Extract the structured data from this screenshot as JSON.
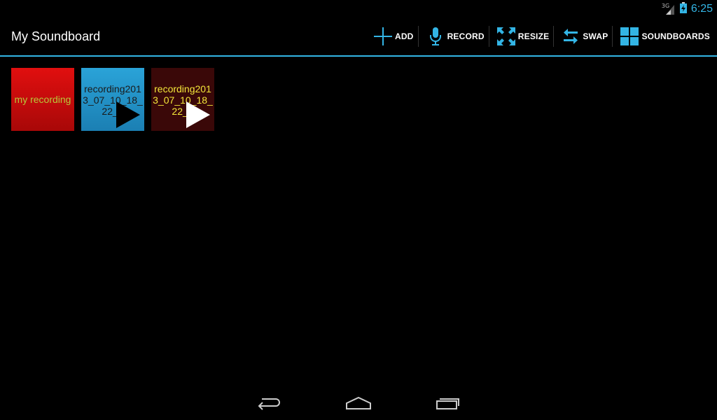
{
  "status_bar": {
    "network_type": "3G",
    "time": "6:25"
  },
  "action_bar": {
    "title": "My Soundboard",
    "actions": [
      {
        "label": "ADD",
        "icon": "plus-icon"
      },
      {
        "label": "RECORD",
        "icon": "microphone-icon"
      },
      {
        "label": "RESIZE",
        "icon": "resize-icon"
      },
      {
        "label": "SWAP",
        "icon": "swap-icon"
      },
      {
        "label": "SOUNDBOARDS",
        "icon": "grid-icon"
      }
    ]
  },
  "tiles": [
    {
      "name": "my recording",
      "has_play": false
    },
    {
      "name": "recording2013_07_10_18_22_5",
      "has_play": true
    },
    {
      "name": "recording2013_07_10_18_22_5",
      "has_play": true
    }
  ],
  "nav_bar": {
    "buttons": [
      "back",
      "home",
      "recent-apps"
    ]
  },
  "colors": {
    "accent": "#33b5e5",
    "tile1": "#d50c0c",
    "tile2": "#239ad0",
    "tile3": "#3a0808"
  }
}
